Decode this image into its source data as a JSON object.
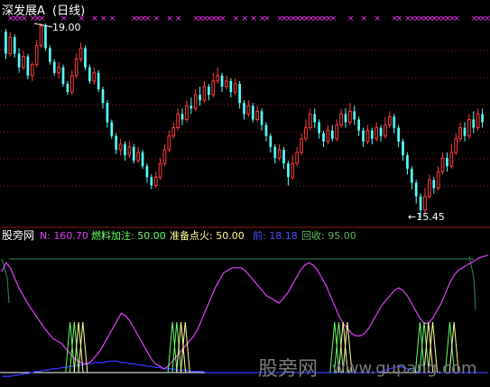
{
  "colors": {
    "bg": "#000000",
    "up": "#ff3c3c",
    "down": "#54ffff",
    "grid": "#8a1a1a",
    "marker": "#ff33ff",
    "white": "#ffffff",
    "n_line": "#e040fb",
    "fuel": "#66ff66",
    "ignite": "#ffff99",
    "dark_green": "#2e8b57",
    "blue_line": "#3333ff",
    "label_blue": "#5050ff",
    "recover": "#5cb85c",
    "watermark": "#7a7a7a"
  },
  "header": {
    "stock": "深发展A",
    "period": "(日线)",
    "high_label": "19.00",
    "low_label": "←15.45"
  },
  "indicator": {
    "site": "股旁网",
    "n_label": "N: 160.70",
    "fuel_label": "燃料加注: 50.00",
    "ignite_label": "准备点火: 50.00",
    "blue_label": "前: 18.18",
    "recover_label": "回收: 95.00"
  },
  "watermark": {
    "cn": "股旁网",
    "url": "www.gupang.com"
  },
  "chart_data": {
    "type": "candlestick",
    "price_high": 19.0,
    "price_low": 15.45,
    "candles": [
      [
        18.85,
        18.45,
        18.9,
        18.35
      ],
      [
        18.45,
        18.75,
        18.85,
        18.4
      ],
      [
        18.75,
        18.45,
        18.8,
        18.38
      ],
      [
        18.45,
        18.2,
        18.55,
        18.1
      ],
      [
        18.2,
        18.4,
        18.5,
        18.15
      ],
      [
        18.4,
        18.05,
        18.45,
        17.98
      ],
      [
        18.05,
        18.25,
        18.3,
        17.95
      ],
      [
        18.25,
        18.6,
        18.7,
        18.2
      ],
      [
        18.6,
        18.95,
        19.0,
        18.55
      ],
      [
        18.95,
        18.55,
        19.0,
        18.5
      ],
      [
        18.55,
        18.3,
        18.6,
        18.25
      ],
      [
        18.3,
        18.1,
        18.35,
        18.05
      ],
      [
        18.1,
        18.2,
        18.3,
        18.0
      ],
      [
        18.2,
        17.9,
        18.25,
        17.85
      ],
      [
        17.9,
        17.75,
        17.95,
        17.7
      ],
      [
        17.75,
        18.05,
        18.15,
        17.7
      ],
      [
        18.05,
        18.35,
        18.45,
        18.0
      ],
      [
        18.35,
        18.55,
        18.65,
        18.3
      ],
      [
        18.55,
        18.2,
        18.6,
        18.15
      ],
      [
        18.2,
        17.95,
        18.25,
        17.9
      ],
      [
        17.95,
        18.1,
        18.2,
        17.88
      ],
      [
        18.1,
        17.8,
        18.15,
        17.75
      ],
      [
        17.8,
        17.55,
        17.85,
        17.45
      ],
      [
        17.55,
        17.2,
        17.6,
        17.1
      ],
      [
        17.2,
        16.95,
        17.25,
        16.9
      ],
      [
        16.95,
        16.7,
        17.0,
        16.62
      ],
      [
        16.7,
        16.8,
        16.9,
        16.6
      ],
      [
        16.8,
        16.6,
        16.85,
        16.5
      ],
      [
        16.6,
        16.75,
        16.85,
        16.55
      ],
      [
        16.75,
        16.5,
        16.8,
        16.45
      ],
      [
        16.5,
        16.65,
        16.75,
        16.45
      ],
      [
        16.65,
        16.4,
        16.7,
        16.35
      ],
      [
        16.4,
        16.2,
        16.45,
        16.1
      ],
      [
        16.2,
        16.05,
        16.25,
        15.98
      ],
      [
        16.05,
        16.2,
        16.3,
        16.0
      ],
      [
        16.2,
        16.45,
        16.55,
        16.15
      ],
      [
        16.45,
        16.7,
        16.8,
        16.4
      ],
      [
        16.7,
        16.95,
        17.05,
        16.65
      ],
      [
        16.95,
        17.1,
        17.2,
        16.9
      ],
      [
        17.1,
        17.35,
        17.45,
        17.05
      ],
      [
        17.35,
        17.25,
        17.45,
        17.15
      ],
      [
        17.25,
        17.5,
        17.6,
        17.2
      ],
      [
        17.5,
        17.45,
        17.65,
        17.35
      ],
      [
        17.45,
        17.7,
        17.8,
        17.4
      ],
      [
        17.7,
        17.6,
        17.85,
        17.5
      ],
      [
        17.6,
        17.85,
        17.95,
        17.55
      ],
      [
        17.85,
        17.7,
        17.9,
        17.6
      ],
      [
        17.7,
        17.95,
        18.1,
        17.65
      ],
      [
        17.95,
        18.05,
        18.2,
        17.9
      ],
      [
        18.05,
        17.85,
        18.1,
        17.75
      ],
      [
        17.85,
        17.95,
        18.05,
        17.8
      ],
      [
        17.95,
        17.75,
        18.0,
        17.65
      ],
      [
        17.75,
        17.9,
        18.0,
        17.7
      ],
      [
        17.9,
        17.55,
        17.95,
        17.45
      ],
      [
        17.55,
        17.35,
        17.6,
        17.25
      ],
      [
        17.35,
        17.5,
        17.6,
        17.3
      ],
      [
        17.5,
        17.25,
        17.55,
        17.2
      ],
      [
        17.25,
        17.4,
        17.5,
        17.2
      ],
      [
        17.4,
        17.15,
        17.45,
        17.05
      ],
      [
        17.15,
        16.95,
        17.2,
        16.85
      ],
      [
        16.95,
        16.75,
        17.0,
        16.65
      ],
      [
        16.75,
        16.55,
        16.8,
        16.45
      ],
      [
        16.55,
        16.7,
        16.8,
        16.5
      ],
      [
        16.7,
        16.45,
        16.75,
        16.35
      ],
      [
        16.45,
        16.2,
        16.5,
        16.05
      ],
      [
        16.2,
        16.45,
        16.6,
        16.15
      ],
      [
        16.45,
        16.65,
        16.75,
        16.4
      ],
      [
        16.65,
        16.9,
        17.0,
        16.6
      ],
      [
        16.9,
        17.1,
        17.25,
        16.85
      ],
      [
        17.1,
        17.35,
        17.45,
        17.05
      ],
      [
        17.35,
        17.2,
        17.45,
        17.1
      ],
      [
        17.2,
        17.0,
        17.25,
        16.9
      ],
      [
        17.0,
        16.85,
        17.05,
        16.75
      ],
      [
        16.85,
        17.05,
        17.15,
        16.8
      ],
      [
        17.05,
        16.9,
        17.15,
        16.85
      ],
      [
        16.9,
        17.15,
        17.25,
        16.85
      ],
      [
        17.15,
        17.35,
        17.45,
        17.1
      ],
      [
        17.35,
        17.2,
        17.45,
        17.1
      ],
      [
        17.2,
        17.4,
        17.55,
        17.15
      ],
      [
        17.4,
        17.25,
        17.5,
        17.15
      ],
      [
        17.25,
        17.05,
        17.3,
        16.95
      ],
      [
        17.05,
        16.85,
        17.1,
        16.75
      ],
      [
        16.85,
        17.05,
        17.15,
        16.8
      ],
      [
        17.05,
        16.9,
        17.1,
        16.8
      ],
      [
        16.9,
        17.1,
        17.2,
        16.85
      ],
      [
        17.1,
        16.95,
        17.15,
        16.85
      ],
      [
        16.95,
        17.15,
        17.3,
        16.9
      ],
      [
        17.15,
        17.3,
        17.4,
        17.1
      ],
      [
        17.3,
        17.1,
        17.35,
        17.0
      ],
      [
        17.1,
        16.85,
        17.15,
        16.75
      ],
      [
        16.85,
        16.6,
        16.9,
        16.5
      ],
      [
        16.6,
        16.35,
        16.65,
        16.25
      ],
      [
        16.35,
        16.1,
        16.4,
        15.98
      ],
      [
        16.1,
        15.85,
        16.15,
        15.72
      ],
      [
        15.85,
        15.6,
        15.9,
        15.45
      ],
      [
        15.6,
        15.85,
        16.0,
        15.55
      ],
      [
        15.85,
        16.15,
        16.25,
        15.8
      ],
      [
        16.15,
        16.0,
        16.2,
        15.9
      ],
      [
        16.0,
        16.3,
        16.4,
        15.95
      ],
      [
        16.3,
        16.55,
        16.65,
        16.25
      ],
      [
        16.55,
        16.4,
        16.65,
        16.3
      ],
      [
        16.4,
        16.65,
        16.8,
        16.35
      ],
      [
        16.65,
        16.9,
        17.0,
        16.6
      ],
      [
        16.9,
        17.1,
        17.2,
        16.85
      ],
      [
        17.1,
        16.95,
        17.2,
        16.85
      ],
      [
        16.95,
        17.25,
        17.35,
        16.9
      ],
      [
        17.25,
        17.1,
        17.4,
        17.0
      ],
      [
        17.1,
        17.35,
        17.45,
        17.05
      ],
      [
        17.35,
        17.2,
        17.45,
        17.1
      ]
    ],
    "markers_top": [
      1,
      2,
      3,
      4,
      6,
      7,
      8,
      13,
      17,
      20,
      22,
      24,
      29,
      30,
      31,
      32,
      34,
      37,
      39,
      43,
      44,
      45,
      46,
      47,
      48,
      49,
      52,
      54,
      56,
      58,
      59,
      62,
      63,
      64,
      65,
      66,
      67,
      68,
      69,
      70,
      71,
      72,
      73,
      74,
      78,
      81,
      84,
      88,
      89,
      91,
      92,
      93,
      94,
      95,
      96,
      97,
      98,
      99,
      100,
      101,
      102,
      106,
      107,
      108,
      109
    ],
    "indicator_series": {
      "N": [
        85,
        92,
        88,
        80,
        72,
        66,
        60,
        55,
        50,
        45,
        40,
        36,
        32,
        30,
        28,
        24,
        20,
        16,
        14,
        12,
        12,
        14,
        18,
        22,
        28,
        34,
        40,
        46,
        52,
        50,
        46,
        40,
        34,
        28,
        22,
        16,
        12,
        10,
        8,
        10,
        14,
        18,
        22,
        26,
        30,
        34,
        40,
        48,
        56,
        64,
        72,
        78,
        84,
        86,
        88,
        88,
        88,
        86,
        82,
        78,
        74,
        70,
        66,
        64,
        62,
        60,
        64,
        68,
        74,
        80,
        86,
        90,
        92,
        90,
        86,
        80,
        74,
        66,
        58,
        50,
        44,
        40,
        36,
        34,
        34,
        36,
        40,
        46,
        52,
        58,
        62,
        66,
        70,
        72,
        70,
        66,
        60,
        54,
        48,
        44,
        44,
        48,
        54,
        60,
        68,
        76,
        82,
        86,
        88,
        90,
        92,
        94,
        96,
        97,
        98
      ],
      "blue": [
        2,
        2,
        2,
        3,
        3,
        4,
        4,
        5,
        6,
        6,
        7,
        7,
        8,
        8,
        9,
        9,
        10,
        10,
        11,
        11,
        12,
        12,
        13,
        13,
        13,
        14,
        14,
        14,
        13,
        13,
        12,
        12,
        11,
        11,
        10,
        10,
        9,
        9,
        8,
        8,
        8,
        7,
        7,
        7,
        6,
        6,
        6,
        6,
        5,
        5,
        5,
        5,
        5,
        5,
        5,
        5,
        5,
        5,
        5,
        5,
        5,
        5,
        5,
        5,
        5,
        5,
        5,
        5,
        5,
        5,
        5,
        5,
        5,
        5,
        5,
        5,
        5,
        5,
        5,
        5,
        5,
        5,
        5,
        5,
        5,
        5,
        5,
        5,
        5,
        6,
        7,
        8,
        9,
        10,
        9,
        8,
        7,
        6,
        5,
        5,
        5,
        5,
        5,
        5,
        5,
        5,
        5,
        5,
        5,
        5,
        5,
        5,
        5,
        5,
        5
      ],
      "fuel_spikes": [
        16,
        17,
        40,
        41,
        78,
        79,
        98,
        99,
        105
      ],
      "ignite_spikes": [
        18,
        19,
        42,
        43,
        80,
        81,
        100,
        101,
        106
      ],
      "recover_level": 95,
      "base_level": 5
    }
  }
}
